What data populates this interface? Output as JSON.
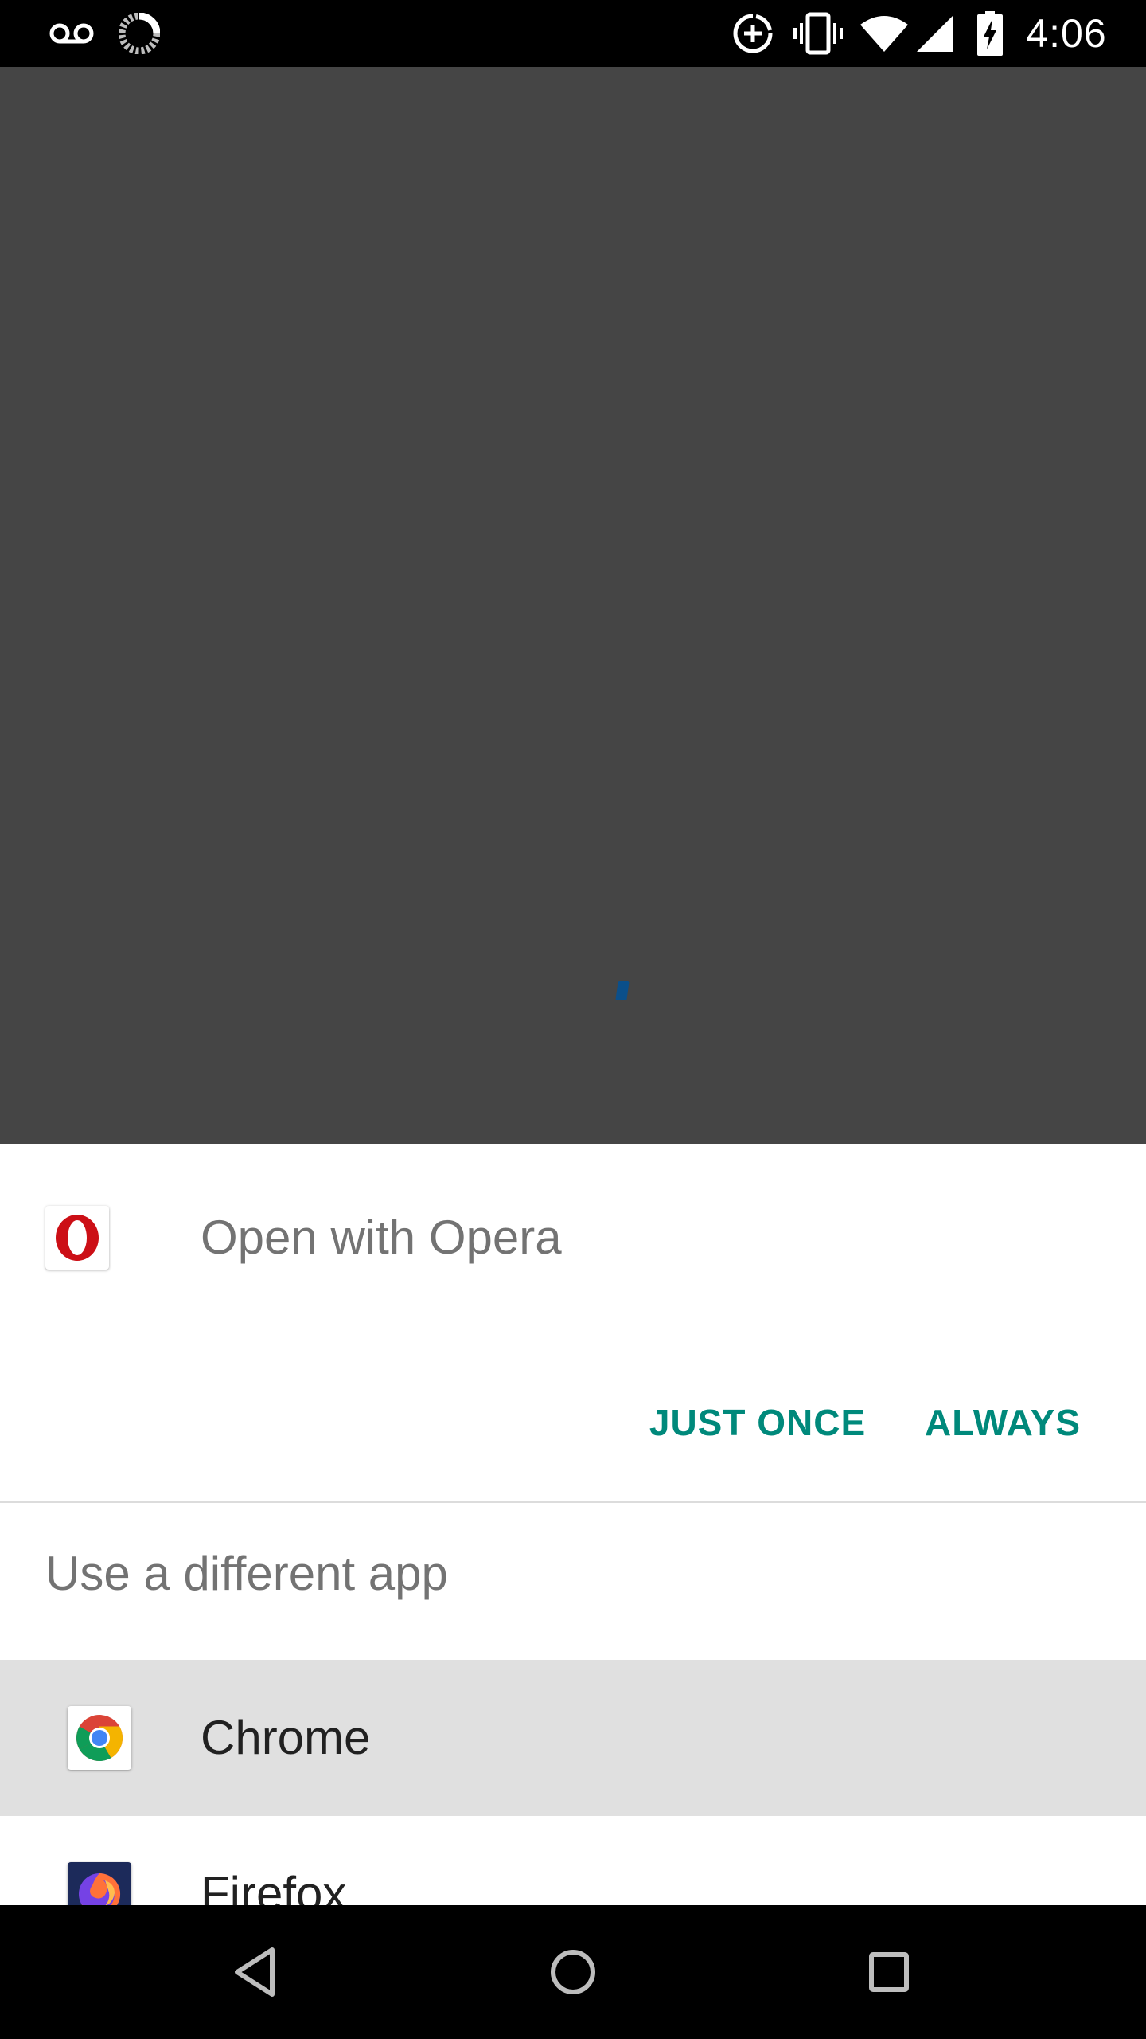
{
  "status_bar": {
    "time": "4:06",
    "icons": [
      "voicemail-icon",
      "sync-icon",
      "data-saver-icon",
      "vibrate-icon",
      "wifi-icon",
      "cell-signal-icon",
      "battery-charging-icon"
    ]
  },
  "dialog": {
    "title": "Open with Opera",
    "app_icon": "opera-icon",
    "buttons": {
      "just_once": "JUST ONCE",
      "always": "ALWAYS"
    },
    "alternate_header": "Use a different app",
    "alternate_apps": [
      {
        "label": "Chrome",
        "icon": "chrome-icon",
        "selected": true
      },
      {
        "label": "Firefox",
        "icon": "firefox-icon",
        "selected": false
      }
    ]
  },
  "nav_bar": {
    "buttons": [
      "back-icon",
      "home-icon",
      "recents-icon"
    ]
  },
  "colors": {
    "accent": "#00897b",
    "background_dim": "#454545",
    "selected_row": "#e0e0e0",
    "opera_red": "#cc0f16"
  }
}
